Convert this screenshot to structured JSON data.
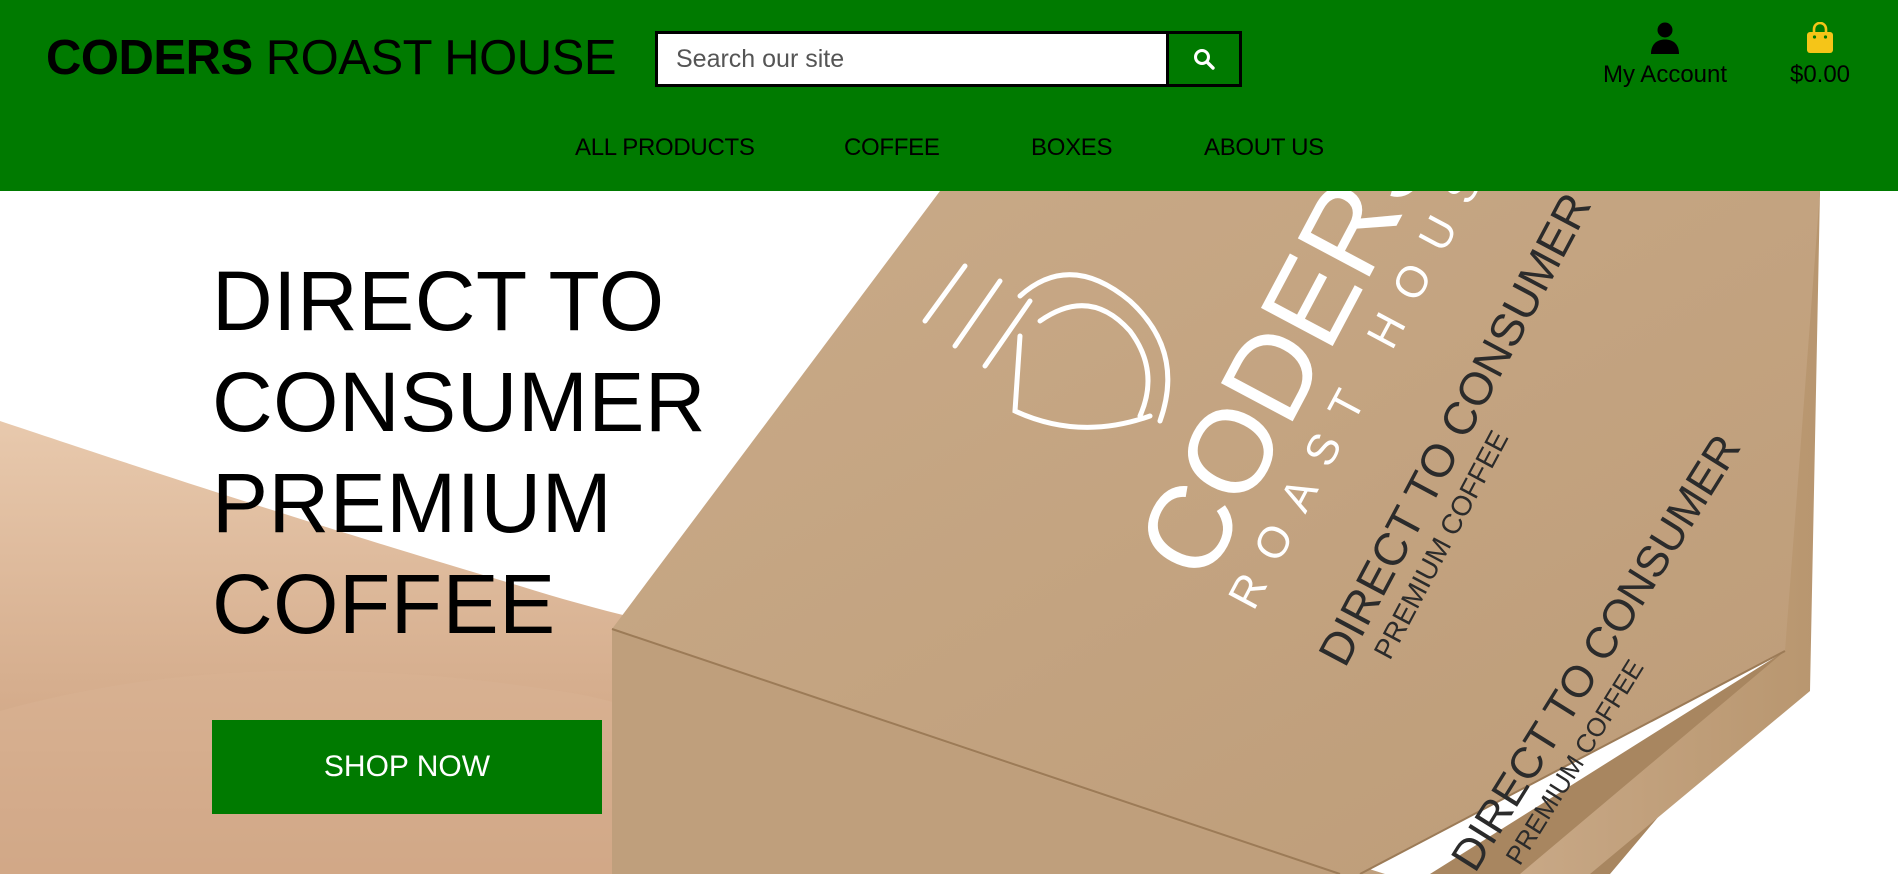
{
  "header": {
    "brand_bold": "CODERS",
    "brand_light": "ROAST HOUSE",
    "search_placeholder": "Search our site",
    "account_label": "My Account",
    "cart_total": "$0.00"
  },
  "nav": {
    "items": [
      "ALL PRODUCTS",
      "COFFEE",
      "BOXES",
      "ABOUT US"
    ]
  },
  "hero": {
    "title_lines": [
      "DIRECT TO",
      "CONSUMER",
      "PREMIUM",
      "COFFEE"
    ],
    "cta_label": "SHOP NOW",
    "box_brand": "CODERS",
    "box_sub": "ROAST HOUSE",
    "box_tagline": "DIRECT TO CONSUMER",
    "box_tagline_sub": "PREMIUM COFFEE"
  },
  "colors": {
    "brand_green": "#007a00",
    "cart_yellow": "#f5c518",
    "box_tan": "#c4a482"
  },
  "icons": {
    "search": "search-icon",
    "account": "user-icon",
    "cart": "shopping-bag-icon"
  }
}
